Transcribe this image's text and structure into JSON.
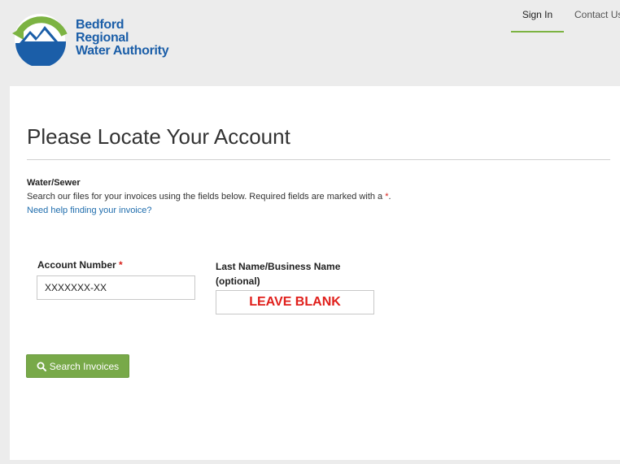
{
  "logo": {
    "line1": "Bedford",
    "line2": "Regional",
    "line3": "Water Authority"
  },
  "nav": {
    "sign_in": "Sign In",
    "contact": "Contact Us"
  },
  "page": {
    "title": "Please Locate Your Account",
    "section_label": "Water/Sewer",
    "instructions": "Search our files for your invoices using the fields below.  Required fields are marked with a ",
    "required_marker": "*",
    "instructions_end": ".",
    "help_link": "Need help finding your invoice?"
  },
  "form": {
    "account_label": "Account Number",
    "account_required": "*",
    "account_value": "XXXXXXX-XX",
    "name_label_line1": "Last Name/Business Name",
    "name_label_line2": "(optional)",
    "name_value": "",
    "name_annotation": "LEAVE BLANK",
    "search_button": "Search Invoices"
  },
  "colors": {
    "brand_blue": "#1b5ea8",
    "accent_green": "#78a949",
    "required_red": "#d9221c",
    "link_blue": "#1f6dad"
  },
  "icons": {
    "logo": "mountain-water-logo-icon",
    "search": "search-icon"
  }
}
